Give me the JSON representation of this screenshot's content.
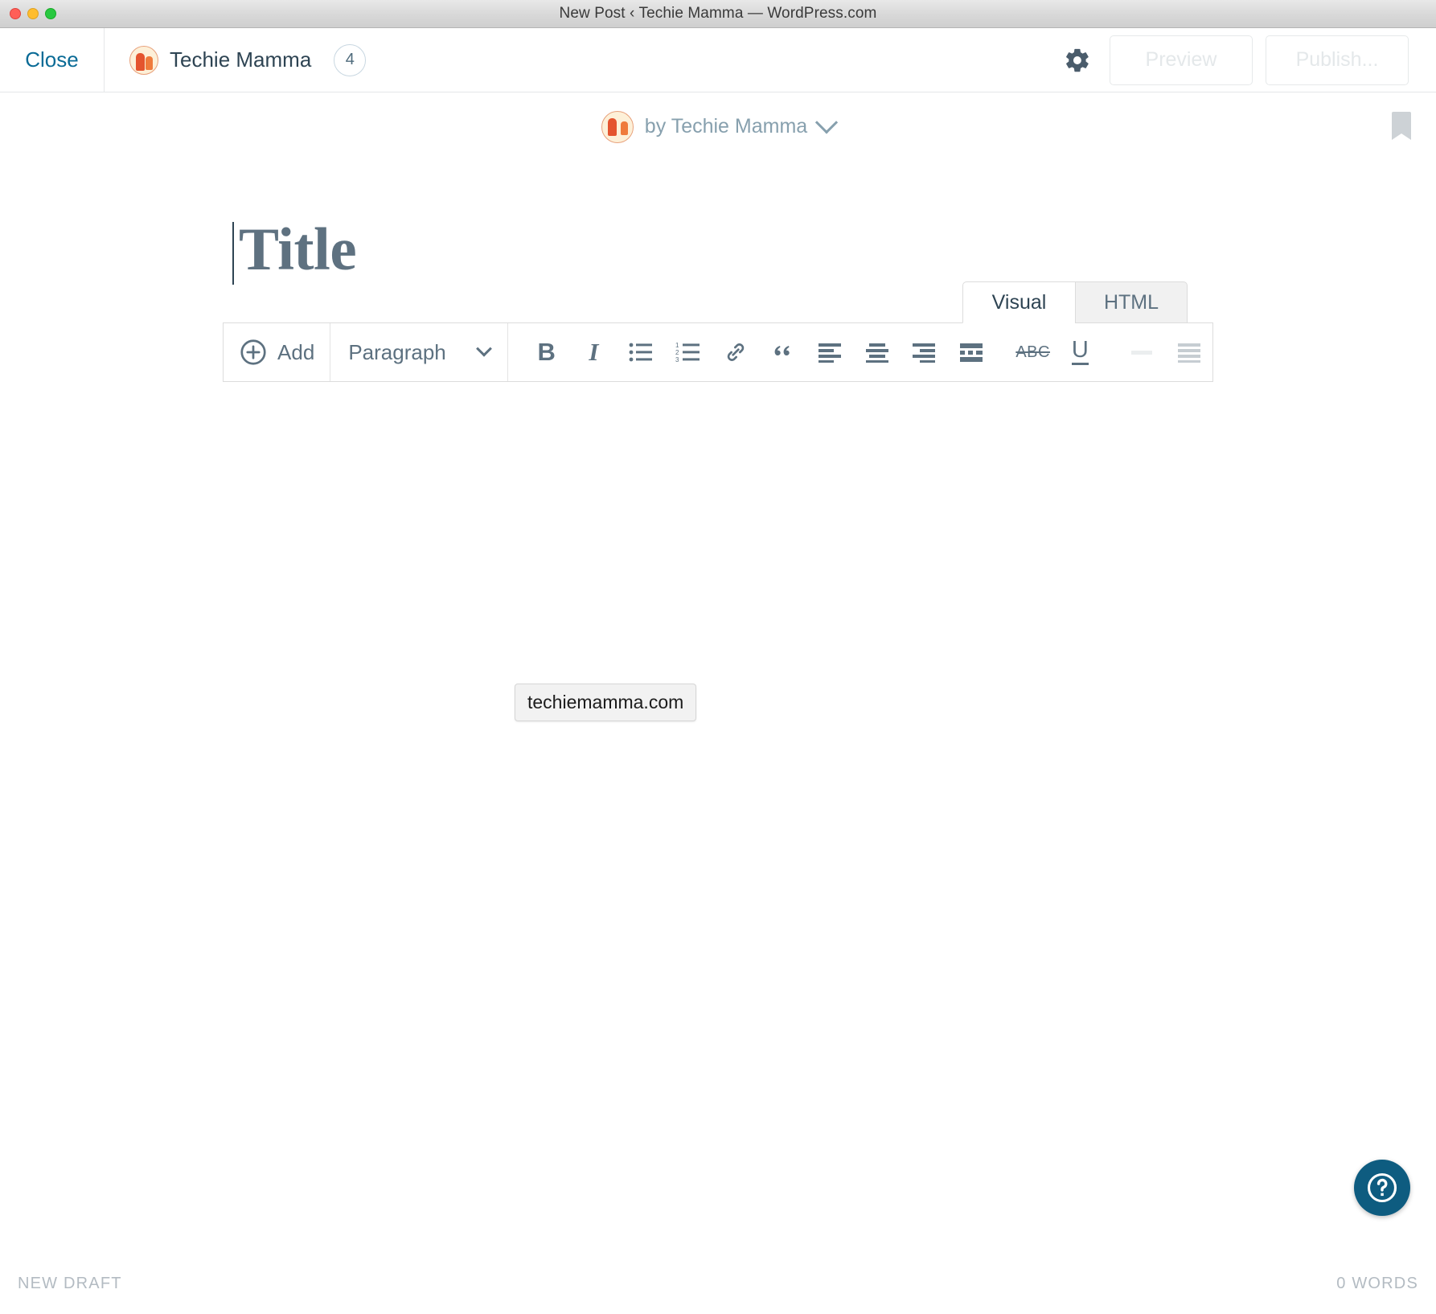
{
  "window": {
    "title": "New Post ‹ Techie Mamma — WordPress.com",
    "traffic_lights": [
      "close",
      "minimize",
      "zoom"
    ]
  },
  "app_bar": {
    "close_label": "Close",
    "site_name": "Techie Mamma",
    "notification_count": "4",
    "gear_icon": "gear-icon",
    "preview_label": "Preview",
    "publish_label": "Publish..."
  },
  "byline": {
    "text": "by Techie Mamma",
    "chevron_icon": "chevron-down-icon",
    "bookmark_icon": "bookmark-icon"
  },
  "editor": {
    "title_placeholder": "Title",
    "tabs": [
      {
        "label": "Visual",
        "active": true
      },
      {
        "label": "HTML",
        "active": false
      }
    ],
    "toolbar": {
      "add_label": "Add",
      "add_icon": "plus-circle-icon",
      "block_format": "Paragraph",
      "block_format_chevron": "chevron-down-icon",
      "buttons": [
        {
          "name": "bold",
          "glyph": "B"
        },
        {
          "name": "italic",
          "glyph": "I"
        },
        {
          "name": "bulleted-list",
          "glyph": ""
        },
        {
          "name": "numbered-list",
          "glyph": ""
        },
        {
          "name": "insert-link",
          "glyph": ""
        },
        {
          "name": "blockquote",
          "glyph": "“"
        },
        {
          "name": "align-left",
          "glyph": ""
        },
        {
          "name": "align-center",
          "glyph": ""
        },
        {
          "name": "align-right",
          "glyph": ""
        },
        {
          "name": "read-more",
          "glyph": ""
        },
        {
          "name": "strikethrough",
          "glyph": "ABC"
        },
        {
          "name": "underline",
          "glyph": "U"
        },
        {
          "name": "horizontal-rule",
          "glyph": ""
        },
        {
          "name": "justify",
          "glyph": ""
        }
      ]
    },
    "url_chip": "techiemamma.com"
  },
  "help": {
    "icon": "question-circle-icon"
  },
  "status": {
    "left": "NEW DRAFT",
    "right": "0 WORDS"
  },
  "colors": {
    "link_blue": "#0a6b96",
    "help_blue": "#0e5c80",
    "icon_slate": "#5d7180",
    "muted": "#b3bbc2",
    "title_gray": "#5e7180"
  }
}
